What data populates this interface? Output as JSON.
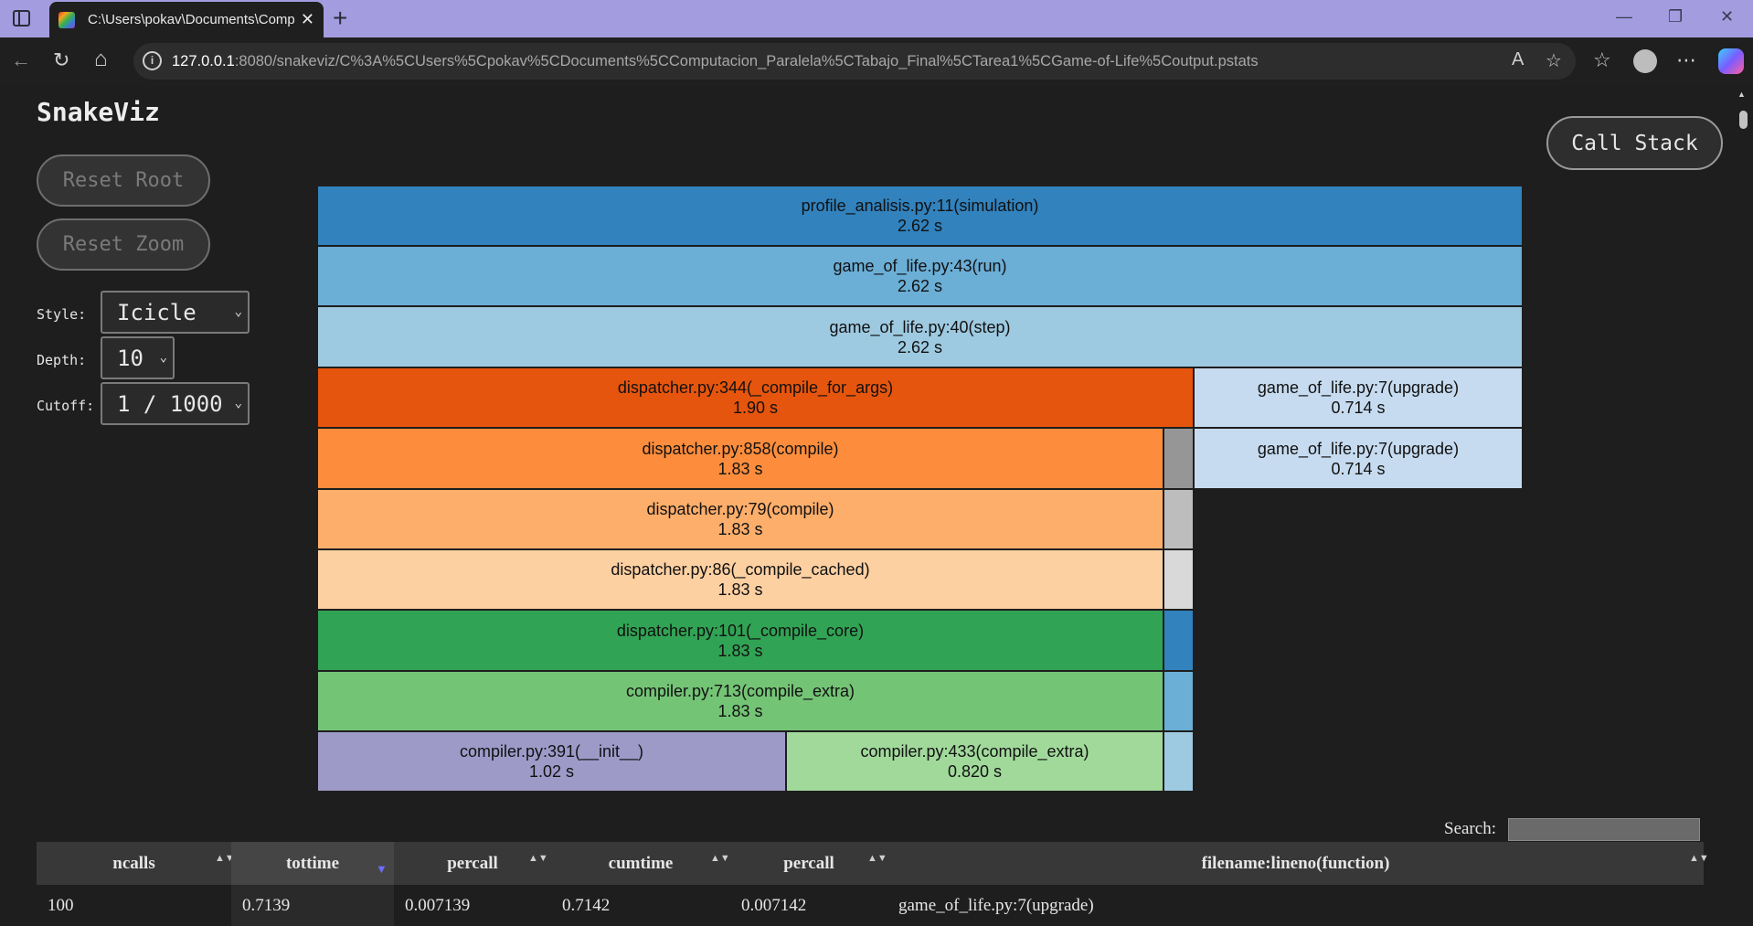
{
  "browser": {
    "tab_title": "C:\\Users\\pokav\\Documents\\Comp",
    "tab_close": "✕",
    "new_tab": "+",
    "url_host": "127.0.0.1",
    "url_rest": ":8080/snakeviz/C%3A%5CUsers%5Cpokav%5CDocuments%5CComputacion_Paralela%5CTabajo_Final%5CTarea1%5CGame-of-Life%5Coutput.pstats",
    "info_icon": "i",
    "minimize": "—",
    "restore": "❐",
    "close": "✕",
    "back": "←",
    "reload": "↻",
    "home": "⌂",
    "read_aloud": "A",
    "favorite": "☆",
    "favorites": "☆",
    "more": "⋯"
  },
  "app": {
    "title": "SnakeViz",
    "reset_root": "Reset Root",
    "reset_zoom": "Reset Zoom",
    "call_stack": "Call Stack",
    "style_label": "Style:",
    "style_value": "Icicle",
    "depth_label": "Depth:",
    "depth_value": "10",
    "cutoff_label": "Cutoff:",
    "cutoff_value": "1 / 1000",
    "chevron": "⌄"
  },
  "icicle": [
    {
      "name": "profile_analisis.py:11(simulation)",
      "time": "2.62 s",
      "color": "#3182bd"
    },
    {
      "name": "game_of_life.py:43(run)",
      "time": "2.62 s",
      "color": "#6baed6"
    },
    {
      "name": "game_of_life.py:40(step)",
      "time": "2.62 s",
      "color": "#9ecae1"
    },
    {
      "name": "dispatcher.py:344(_compile_for_args)",
      "time": "1.90 s",
      "color": "#e6550d"
    },
    {
      "name": "game_of_life.py:7(upgrade)",
      "time": "0.714 s",
      "color": "#c6dbef"
    },
    {
      "name": "dispatcher.py:858(compile)",
      "time": "1.83 s",
      "color": "#fd8d3c"
    },
    {
      "name": "game_of_life.py:7(upgrade)",
      "time": "0.714 s",
      "color": "#c6dbef"
    },
    {
      "name": "dispatcher.py:79(compile)",
      "time": "1.83 s",
      "color": "#fdae6b"
    },
    {
      "name": "dispatcher.py:86(_compile_cached)",
      "time": "1.83 s",
      "color": "#fdd0a2"
    },
    {
      "name": "dispatcher.py:101(_compile_core)",
      "time": "1.83 s",
      "color": "#31a354"
    },
    {
      "name": "compiler.py:713(compile_extra)",
      "time": "1.83 s",
      "color": "#74c476"
    },
    {
      "name": "compiler.py:391(__init__)",
      "time": "1.02 s",
      "color": "#9e9ac8"
    },
    {
      "name": "compiler.py:433(compile_extra)",
      "time": "0.820 s",
      "color": "#a1d99b"
    },
    {
      "name": "",
      "time": "",
      "color": "#969696"
    },
    {
      "name": "",
      "time": "",
      "color": "#bdbdbd"
    },
    {
      "name": "",
      "time": "",
      "color": "#d9d9d9"
    },
    {
      "name": "",
      "time": "",
      "color": "#3182bd"
    },
    {
      "name": "",
      "time": "",
      "color": "#6baed6"
    },
    {
      "name": "",
      "time": "",
      "color": "#9ecae1"
    }
  ],
  "table": {
    "search_label": "Search:",
    "sort_both": "▲▼",
    "sort_desc": "▼",
    "headers": [
      "ncalls",
      "tottime",
      "percall",
      "cumtime",
      "percall",
      "filename:lineno(function)"
    ],
    "rows": [
      [
        "100",
        "0.7139",
        "0.007139",
        "0.7142",
        "0.007142",
        "game_of_life.py:7(upgrade)"
      ]
    ]
  }
}
